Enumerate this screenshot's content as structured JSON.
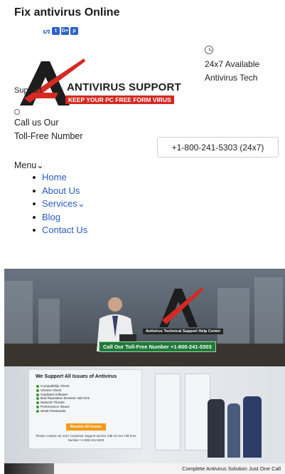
{
  "header": {
    "site_title": "Fix antivirus Online",
    "social": [
      "stumbleupon-icon",
      "twitter-icon",
      "googleplus-icon",
      "pinterest-icon"
    ],
    "social_glyphs": [
      "ᔕ",
      "t",
      "G+",
      "p"
    ]
  },
  "availability": {
    "icon": "clock-icon",
    "text": "24x7 Available Antivirus Tech"
  },
  "logo": {
    "brand": "ANTIVIRUS SUPPORT",
    "tagline": "KEEP YOUR PC FREE FORM VIRUS",
    "overlap_text": "Support",
    "colors": {
      "red": "#d42a22",
      "dark": "#1d1d1d"
    }
  },
  "call": {
    "line1": "Call us Our",
    "line2": "Toll-Free Number",
    "phone": "+1-800-241-5303 (24x7)"
  },
  "nav": {
    "toggle_label": "Menu",
    "toggle_arrow": "⌄",
    "items": [
      "Home",
      "About Us",
      "Services",
      "Blog",
      "Contact Us"
    ],
    "services_arrow": "⌄",
    "link_color": "#2a5ac9"
  },
  "banner": {
    "slide1": {
      "tag": "Antivirus Technical Support Help Center",
      "cta": "Call Our Toll-Free Number +1-800-241-5303"
    },
    "slide2": {
      "heading": "We Support All Issues of Antivirus",
      "issues": [
        "Compatibility Check",
        "Viruses Check",
        "Outdated Software",
        "Bad Reputation Browser Add-Ons",
        "Network Threats",
        "Performance Issues",
        "Weak Passwords"
      ],
      "button": "Resolve All Issues",
      "contact": "Please contact our 24x7 Customer Support service Call Us Our Toll-Free Number +1-800-241-5303"
    },
    "slide3": {
      "text": "Complete Antivirus Solution Just One Call"
    }
  }
}
